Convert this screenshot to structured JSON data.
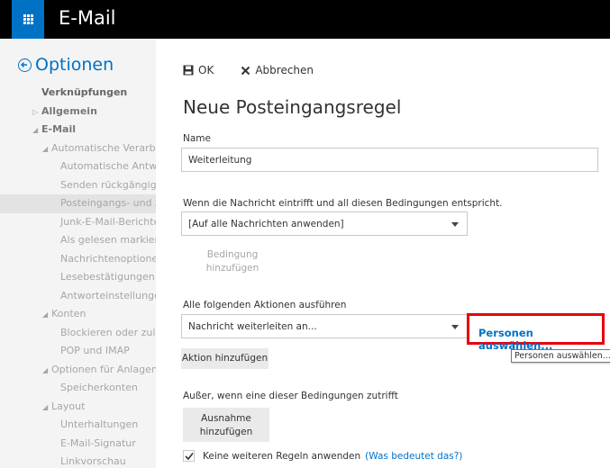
{
  "header": {
    "title": "E-Mail"
  },
  "sidebar": {
    "heading": "Optionen",
    "items": [
      {
        "label": "Verknüpfungen",
        "level": 0,
        "arrow": ""
      },
      {
        "label": "Allgemein",
        "level": 1,
        "arrow": "▷"
      },
      {
        "label": "E-Mail",
        "level": 1,
        "arrow": "◢"
      },
      {
        "label": "Automatische Verarbeitung",
        "level": 2,
        "arrow": "◢"
      },
      {
        "label": "Automatische Antworten",
        "level": 3,
        "arrow": ""
      },
      {
        "label": "Senden rückgängig machen",
        "level": 3,
        "arrow": ""
      },
      {
        "label": "Posteingangs- und Aufräumregeln",
        "level": 3,
        "arrow": ""
      },
      {
        "label": "Junk-E-Mail-Berichterstattung",
        "level": 3,
        "arrow": ""
      },
      {
        "label": "Als gelesen markieren",
        "level": 3,
        "arrow": ""
      },
      {
        "label": "Nachrichtenoptionen",
        "level": 3,
        "arrow": ""
      },
      {
        "label": "Lesebestätigungen",
        "level": 3,
        "arrow": ""
      },
      {
        "label": "Antworteinstellungen",
        "level": 3,
        "arrow": ""
      },
      {
        "label": "Konten",
        "level": 2,
        "arrow": "◢"
      },
      {
        "label": "Blockieren oder zulassen",
        "level": 3,
        "arrow": ""
      },
      {
        "label": "POP und IMAP",
        "level": 3,
        "arrow": ""
      },
      {
        "label": "Optionen für Anlagen",
        "level": 2,
        "arrow": "◢"
      },
      {
        "label": "Speicherkonten",
        "level": 3,
        "arrow": ""
      },
      {
        "label": "Layout",
        "level": 2,
        "arrow": "◢"
      },
      {
        "label": "Unterhaltungen",
        "level": 3,
        "arrow": ""
      },
      {
        "label": "E-Mail-Signatur",
        "level": 3,
        "arrow": ""
      },
      {
        "label": "Linkvorschau",
        "level": 3,
        "arrow": ""
      }
    ]
  },
  "toolbar": {
    "ok_label": "OK",
    "cancel_label": "Abbrechen"
  },
  "form": {
    "title": "Neue Posteingangsregel",
    "name_label": "Name",
    "name_value": "Weiterleitung",
    "condition_label": "Wenn die Nachricht eintrifft und all diesen Bedingungen entspricht.",
    "condition_value": "[Auf alle Nachrichten anwenden]",
    "add_condition_line1": "Bedingung",
    "add_condition_line2": "hinzufügen",
    "actions_label": "Alle folgenden Aktionen ausführen",
    "action_value": "Nachricht weiterleiten an...",
    "select_people_link": "Personen auswählen...",
    "select_people_tooltip": "Personen auswählen...",
    "add_action_label": "Aktion hinzufügen",
    "exception_label": "Außer, wenn eine dieser Bedingungen zutrifft",
    "add_exception_line1": "Ausnahme",
    "add_exception_line2": "hinzufügen",
    "stop_rules_label": "Keine weiteren Regeln anwenden",
    "stop_rules_checked": true,
    "help_link": "(Was bedeutet das?)"
  },
  "colors": {
    "accent": "#0072c6",
    "highlight": "#e8000b",
    "topbar": "#000000"
  }
}
